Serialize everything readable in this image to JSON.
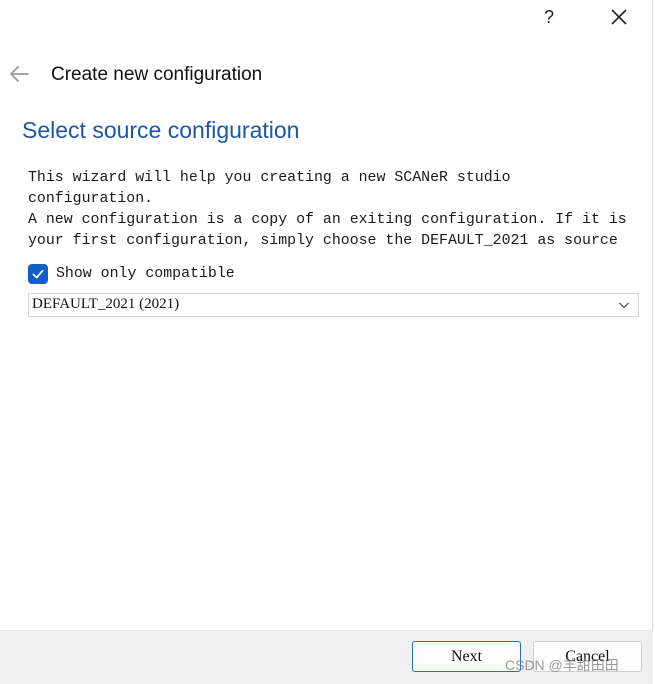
{
  "titlebar": {
    "help_label": "?",
    "close_icon": "close-icon"
  },
  "header": {
    "back_icon": "arrow-left-icon",
    "title": "Create new configuration"
  },
  "page": {
    "title": "Select source configuration",
    "description_line1": "This wizard will help you creating a new SCANeR studio",
    "description_line2": "configuration.",
    "description_line3": "A new configuration is a copy of an exiting configuration. If it is",
    "description_line4": "your first configuration, simply choose the DEFAULT_2021 as source"
  },
  "filter": {
    "checked": true,
    "label": "Show only compatible"
  },
  "source_select": {
    "selected_value": "DEFAULT_2021 (2021)"
  },
  "footer": {
    "next_label": "Next",
    "cancel_label": "Cancel"
  },
  "watermark": {
    "text": "CSDN @羊甜田田"
  },
  "colors": {
    "accent": "#1b56a8",
    "checkbox": "#0f5fc4",
    "primary_border": "#1f6fd0",
    "footer_bg": "#f0f0f0"
  }
}
